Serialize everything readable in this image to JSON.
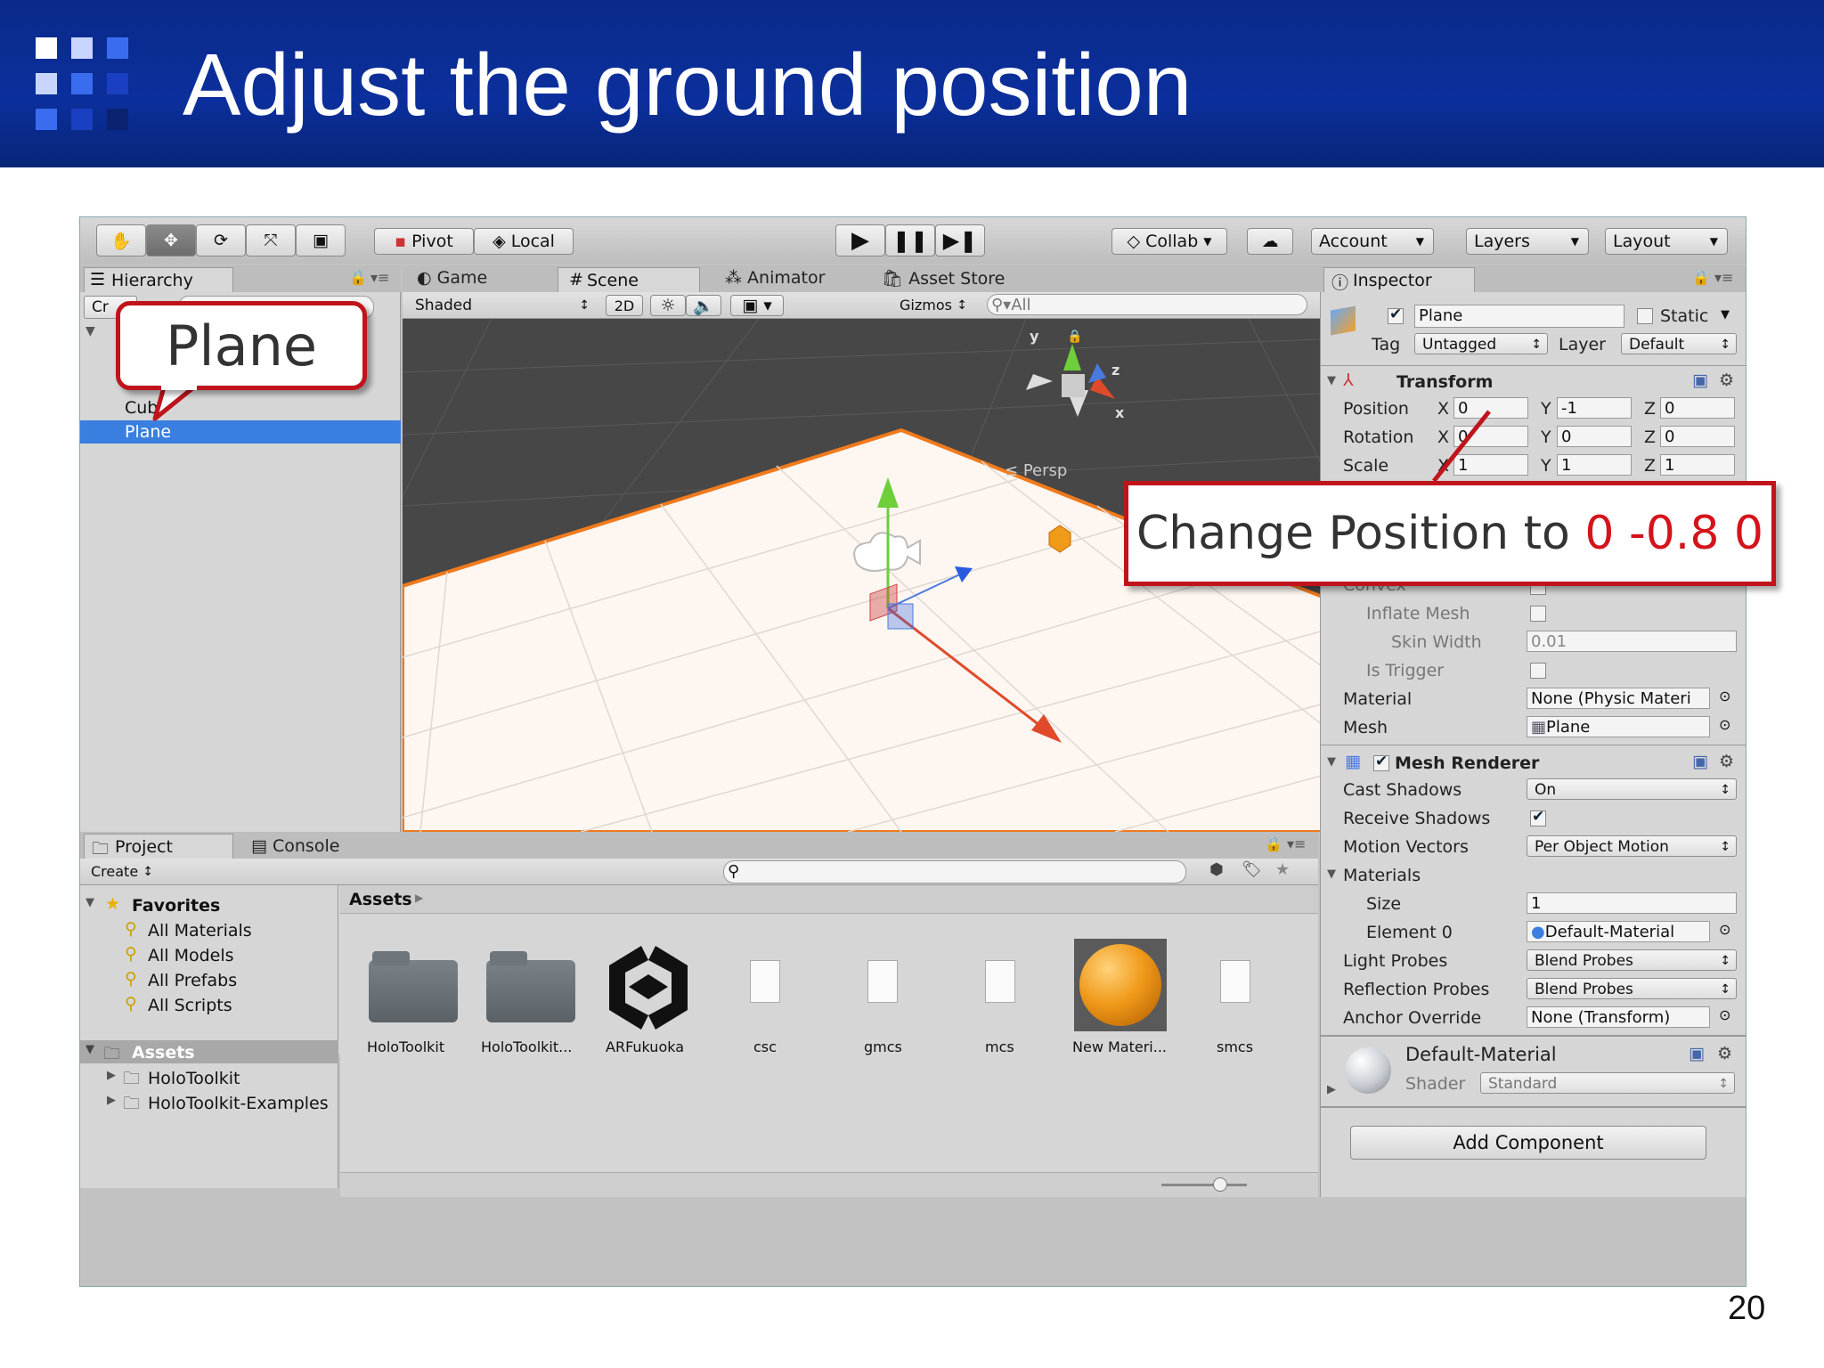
{
  "slide": {
    "title": "Adjust the ground position",
    "page_number": "20"
  },
  "toolbar": {
    "pivot": "Pivot",
    "local": "Local",
    "collab": "Collab",
    "account": "Account",
    "layers": "Layers",
    "layout": "Layout"
  },
  "hierarchy": {
    "tab": "Hierarchy",
    "create_partial": "Cr",
    "items": [
      "Cub",
      "Plane"
    ]
  },
  "scene": {
    "tabs": [
      "Game",
      "Scene",
      "Animator",
      "Asset Store"
    ],
    "shaded": "Shaded",
    "mode_2d": "2D",
    "gizmos": "Gizmos",
    "search_all": "All",
    "persp": "Persp",
    "axis_y": "y",
    "axis_x": "x",
    "axis_z": "z"
  },
  "project": {
    "tabs": [
      "Project",
      "Console"
    ],
    "create": "Create",
    "favorites_header": "Favorites",
    "favorites": [
      "All Materials",
      "All Models",
      "All Prefabs",
      "All Scripts"
    ],
    "assets_header": "Assets",
    "asset_folders": [
      "HoloToolkit",
      "HoloToolkit-Examples"
    ],
    "breadcrumb": "Assets",
    "asset_items": [
      "HoloToolkit",
      "HoloToolkit...",
      "ARFukuoka",
      "csc",
      "gmcs",
      "mcs",
      "New Materi...",
      "smcs"
    ]
  },
  "inspector": {
    "tab": "Inspector",
    "object_name": "Plane",
    "static_label": "Static",
    "tag_label": "Tag",
    "tag_value": "Untagged",
    "layer_label": "Layer",
    "layer_value": "Default",
    "transform": {
      "header": "Transform",
      "rows": [
        {
          "label": "Position",
          "x": "0",
          "y": "-1",
          "z": "0"
        },
        {
          "label": "Rotation",
          "x": "0",
          "y": "0",
          "z": "0"
        },
        {
          "label": "Scale",
          "x": "1",
          "y": "1",
          "z": "1"
        }
      ],
      "axis_x": "X",
      "axis_y": "Y",
      "axis_z": "Z"
    },
    "mesh_collider": {
      "convex": "Convex",
      "inflate_mesh": "Inflate Mesh",
      "skin_width": "Skin Width",
      "skin_width_value": "0.01",
      "is_trigger": "Is Trigger",
      "material": "Material",
      "material_value": "None (Physic Materi",
      "mesh": "Mesh",
      "mesh_value": "Plane"
    },
    "mesh_renderer": {
      "header": "Mesh Renderer",
      "cast_shadows": "Cast Shadows",
      "cast_shadows_value": "On",
      "receive_shadows": "Receive Shadows",
      "motion_vectors": "Motion Vectors",
      "motion_vectors_value": "Per Object Motion",
      "materials": "Materials",
      "size": "Size",
      "size_value": "1",
      "element0": "Element 0",
      "element0_value": "Default-Material",
      "light_probes": "Light Probes",
      "light_probes_value": "Blend Probes",
      "reflection_probes": "Reflection Probes",
      "reflection_probes_value": "Blend Probes",
      "anchor_override": "Anchor Override",
      "anchor_override_value": "None (Transform)"
    },
    "material": {
      "name": "Default-Material",
      "shader_label": "Shader",
      "shader_value": "Standard"
    },
    "add_component": "Add Component"
  },
  "callouts": {
    "plane": "Plane",
    "change_prefix": "Change Position to ",
    "change_value": "0 -0.8 0"
  },
  "colors": {
    "header_blue": "#0b2f9c",
    "callout_red": "#c0141c",
    "selection_blue": "#3a7fe0",
    "scene_dark": "#474747",
    "plane_orange": "#f07a1c"
  }
}
